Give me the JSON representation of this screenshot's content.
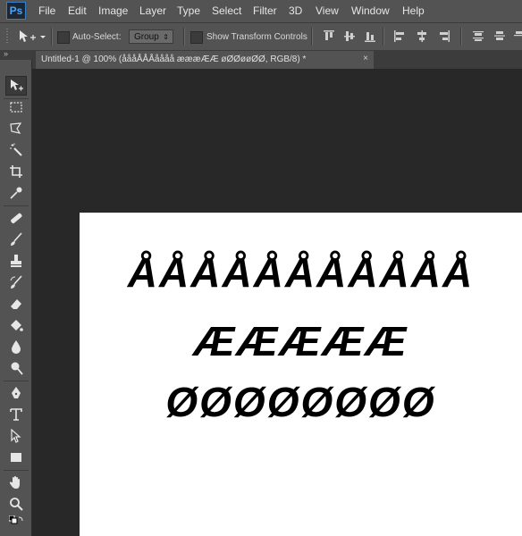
{
  "app": {
    "logo": "Ps"
  },
  "menu": [
    "File",
    "Edit",
    "Image",
    "Layer",
    "Type",
    "Select",
    "Filter",
    "3D",
    "View",
    "Window",
    "Help"
  ],
  "options_bar": {
    "auto_select_label": "Auto-Select:",
    "group_value": "Group",
    "show_transform_label": "Show Transform Controls"
  },
  "tools_panel": {
    "collapse_glyph": "»"
  },
  "document": {
    "tab_title": "Untitled-1 @ 100% (åååÅÅÅåååå æææÆÆ øØØøøØØ, RGB/8) *",
    "close_glyph": "×"
  },
  "canvas_text": {
    "line1": "ÅÅÅÅÅÅÅÅÅÅÅ",
    "line2": "ÆÆÆÆÆ",
    "line3": "ØØØØØØØØ"
  },
  "colors": {
    "ui_panel": "#535353",
    "workspace": "#282828",
    "canvas": "#ffffff",
    "text": "#000000"
  },
  "icons": [
    "move-tool-icon",
    "marquee-icon",
    "lasso-icon",
    "magic-wand-icon",
    "crop-icon",
    "eyedropper-icon",
    "healing-brush-icon",
    "brush-icon",
    "clone-stamp-icon",
    "history-brush-icon",
    "eraser-icon",
    "paint-bucket-icon",
    "blur-icon",
    "dodge-icon",
    "pen-icon",
    "type-icon",
    "path-selection-icon",
    "rectangle-icon",
    "hand-icon",
    "zoom-icon"
  ]
}
